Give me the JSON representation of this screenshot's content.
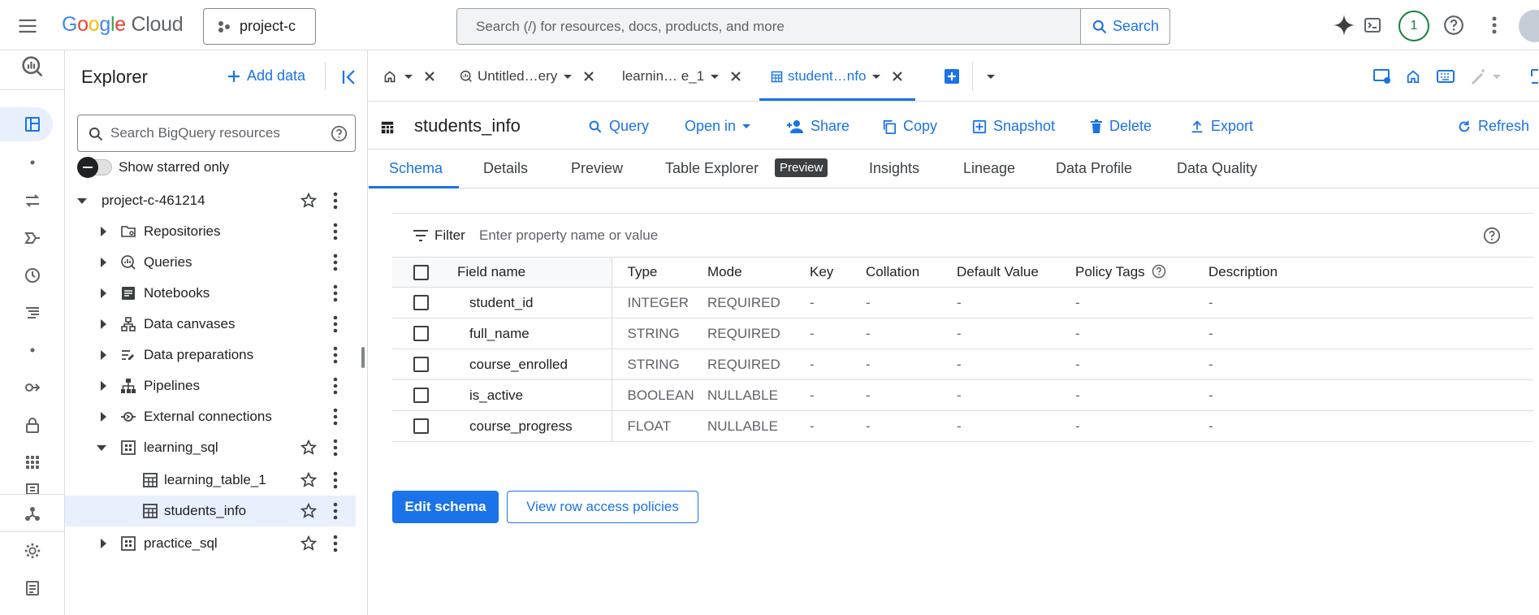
{
  "topbar": {
    "logo": {
      "letters": [
        "G",
        "o",
        "o",
        "g",
        "l",
        "e"
      ],
      "suffix": "Cloud"
    },
    "project": "project-c",
    "search_placeholder": "Search (/) for resources, docs, products, and more",
    "search_button": "Search",
    "notification_count": "1"
  },
  "explorer": {
    "title": "Explorer",
    "add_data": "Add data",
    "search_placeholder": "Search BigQuery resources",
    "starred_toggle": "Show starred only",
    "tree": [
      {
        "label": "project-c-461214",
        "icon": "none",
        "expanded": true
      },
      {
        "label": "Repositories",
        "icon": "repository-icon"
      },
      {
        "label": "Queries",
        "icon": "query-icon"
      },
      {
        "label": "Notebooks",
        "icon": "notebook-icon"
      },
      {
        "label": "Data canvases",
        "icon": "canvas-icon"
      },
      {
        "label": "Data preparations",
        "icon": "data-prep-icon"
      },
      {
        "label": "Pipelines",
        "icon": "pipeline-icon"
      },
      {
        "label": "External connections",
        "icon": "connection-icon"
      },
      {
        "label": "learning_sql",
        "icon": "dataset-icon",
        "expanded": true
      },
      {
        "label": "learning_table_1",
        "icon": "table-icon"
      },
      {
        "label": "students_info",
        "icon": "table-icon",
        "selected": true
      },
      {
        "label": "practice_sql",
        "icon": "dataset-icon"
      }
    ]
  },
  "tabs": [
    {
      "label": "Untitled…ery",
      "icon": "query-icon"
    },
    {
      "label": "learnin…  e_1",
      "icon": "none"
    },
    {
      "label": "student…nfo",
      "icon": "table-icon",
      "active": true
    }
  ],
  "toolbar": {
    "title": "students_info",
    "query": "Query",
    "open_in": "Open in",
    "share": "Share",
    "copy": "Copy",
    "snapshot": "Snapshot",
    "delete": "Delete",
    "export": "Export",
    "refresh": "Refresh"
  },
  "subtabs": {
    "schema": "Schema",
    "details": "Details",
    "preview": "Preview",
    "table_explorer": "Table Explorer",
    "preview_badge": "Preview",
    "insights": "Insights",
    "lineage": "Lineage",
    "data_profile": "Data Profile",
    "data_quality": "Data Quality"
  },
  "schema": {
    "filter_label": "Filter",
    "filter_placeholder": "Enter property name or value",
    "columns": {
      "field_name": "Field name",
      "type": "Type",
      "mode": "Mode",
      "key": "Key",
      "collation": "Collation",
      "default_value": "Default Value",
      "policy_tags": "Policy Tags",
      "description": "Description"
    },
    "rows": [
      {
        "name": "student_id",
        "type": "INTEGER",
        "mode": "REQUIRED",
        "key": "-",
        "collation": "-",
        "default": "-",
        "policy": "-",
        "description": "-"
      },
      {
        "name": "full_name",
        "type": "STRING",
        "mode": "REQUIRED",
        "key": "-",
        "collation": "-",
        "default": "-",
        "policy": "-",
        "description": "-"
      },
      {
        "name": "course_enrolled",
        "type": "STRING",
        "mode": "REQUIRED",
        "key": "-",
        "collation": "-",
        "default": "-",
        "policy": "-",
        "description": "-"
      },
      {
        "name": "is_active",
        "type": "BOOLEAN",
        "mode": "NULLABLE",
        "key": "-",
        "collation": "-",
        "default": "-",
        "policy": "-",
        "description": "-"
      },
      {
        "name": "course_progress",
        "type": "FLOAT",
        "mode": "NULLABLE",
        "key": "-",
        "collation": "-",
        "default": "-",
        "policy": "-",
        "description": "-"
      }
    ],
    "edit_button": "Edit schema",
    "row_access_button": "View row access policies"
  }
}
